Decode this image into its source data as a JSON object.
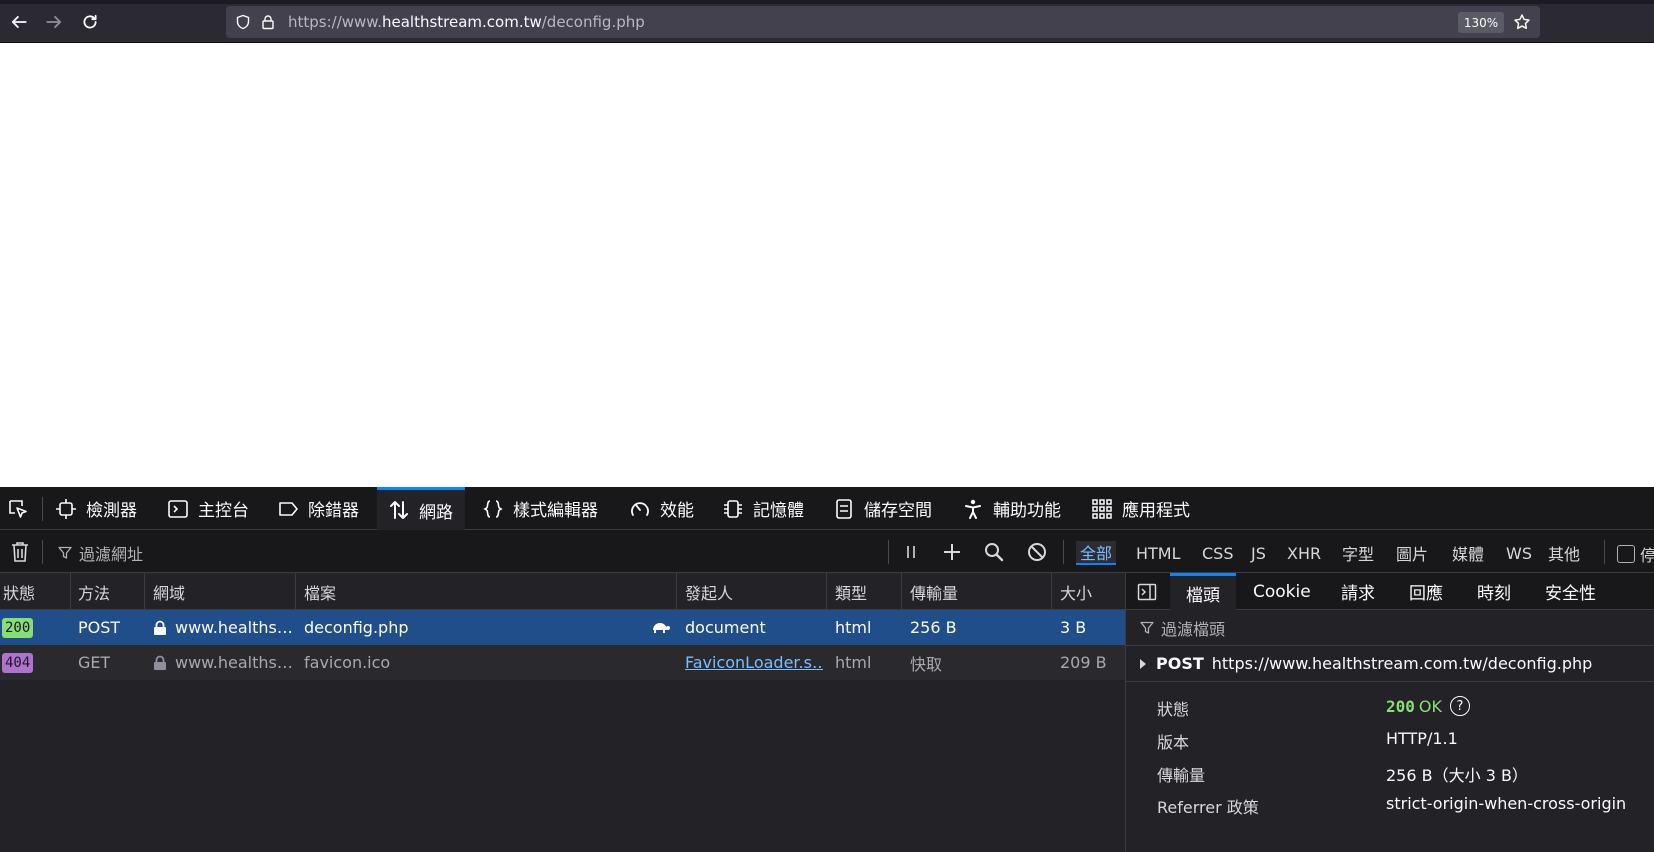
{
  "browser": {
    "url_prefix": "https://www.",
    "url_host": "healthstream.com.tw",
    "url_path": "/deconfig.php",
    "zoom": "130%"
  },
  "devtools": {
    "tabs": [
      {
        "label": "檢測器",
        "icon": "inspector-icon"
      },
      {
        "label": "主控台",
        "icon": "console-icon"
      },
      {
        "label": "除錯器",
        "icon": "debugger-icon"
      },
      {
        "label": "網路",
        "icon": "network-icon"
      },
      {
        "label": "樣式編輯器",
        "icon": "style-editor-icon"
      },
      {
        "label": "效能",
        "icon": "performance-icon"
      },
      {
        "label": "記憶體",
        "icon": "memory-icon"
      },
      {
        "label": "儲存空間",
        "icon": "storage-icon"
      },
      {
        "label": "輔助功能",
        "icon": "accessibility-icon"
      },
      {
        "label": "應用程式",
        "icon": "application-icon"
      }
    ],
    "filter_placeholder": "過濾網址",
    "type_filters": [
      "全部",
      "HTML",
      "CSS",
      "JS",
      "XHR",
      "字型",
      "圖片",
      "媒體",
      "WS",
      "其他"
    ],
    "persist_label": "停",
    "columns": [
      "狀態",
      "方法",
      "網域",
      "檔案",
      "發起人",
      "類型",
      "傳輸量",
      "大小"
    ],
    "requests": [
      {
        "status": "200",
        "method": "POST",
        "domain": "www.healths…",
        "file": "deconfig.php",
        "initiator": "document",
        "type": "html",
        "transferred": "256 B",
        "size": "3 B"
      },
      {
        "status": "404",
        "method": "GET",
        "domain": "www.healths…",
        "file": "favicon.ico",
        "initiator": "FaviconLoader.s…",
        "type": "html",
        "transferred": "快取",
        "size": "209 B"
      }
    ],
    "details": {
      "tabs": [
        "檔頭",
        "Cookie",
        "請求",
        "回應",
        "時刻",
        "安全性"
      ],
      "filter_placeholder": "過濾檔頭",
      "method": "POST",
      "url": "https://www.healthstream.com.tw/deconfig.php",
      "status_label": "狀態",
      "status_code": "200",
      "status_text": "OK",
      "version_label": "版本",
      "version": "HTTP/1.1",
      "transferred_label": "傳輸量",
      "transferred": "256 B（大小 3 B）",
      "referrer_label": "Referrer 政策",
      "referrer": "strict-origin-when-cross-origin"
    }
  },
  "colors": {
    "accent": "#0a84ff",
    "status_200": "#86de74",
    "status_404": "#b072d1",
    "selected_row": "#204e8a"
  }
}
